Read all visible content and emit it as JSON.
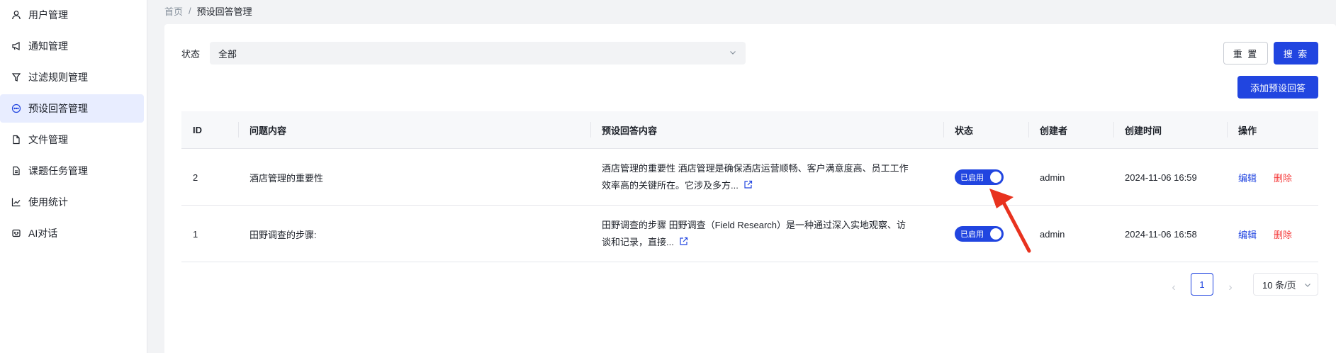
{
  "sidebar": {
    "items": [
      {
        "label": "用户管理",
        "icon": "user-icon"
      },
      {
        "label": "通知管理",
        "icon": "megaphone-icon"
      },
      {
        "label": "过滤规则管理",
        "icon": "filter-icon"
      },
      {
        "label": "预设回答管理",
        "icon": "chat-bubble-icon",
        "active": true
      },
      {
        "label": "文件管理",
        "icon": "file-icon"
      },
      {
        "label": "课题任务管理",
        "icon": "document-icon"
      },
      {
        "label": "使用统计",
        "icon": "line-chart-icon"
      },
      {
        "label": "AI对话",
        "icon": "robot-icon"
      }
    ]
  },
  "breadcrumb": {
    "home": "首页",
    "separator": "/",
    "current": "预设回答管理"
  },
  "filter": {
    "label": "状态",
    "value": "全部"
  },
  "buttons": {
    "reset": "重 置",
    "search": "搜 索",
    "add": "添加预设回答"
  },
  "table": {
    "headers": [
      "ID",
      "问题内容",
      "预设回答内容",
      "状态",
      "创建者",
      "创建时间",
      "操作"
    ],
    "rows": [
      {
        "id": "2",
        "question": "酒店管理的重要性",
        "answer_line1": "酒店管理的重要性 酒店管理是确保酒店运营顺畅、客户满意度高、员工工作",
        "answer_line2": "效率高的关键所在。它涉及多方...",
        "status": "已启用",
        "creator": "admin",
        "created_at": "2024-11-06 16:59",
        "edit": "编辑",
        "delete": "删除"
      },
      {
        "id": "1",
        "question": "田野调查的步骤:",
        "answer_line1": "田野调查的步骤 田野调查（Field Research）是一种通过深入实地观察、访",
        "answer_line2": "谈和记录，直接...",
        "status": "已启用",
        "creator": "admin",
        "created_at": "2024-11-06 16:58",
        "edit": "编辑",
        "delete": "删除"
      }
    ]
  },
  "pagination": {
    "prev": "‹",
    "current_page": "1",
    "next": "›",
    "page_size": "10 条/页"
  },
  "colors": {
    "primary": "#2145e0",
    "danger": "#f53f3f",
    "annotation_arrow": "#e8321e"
  }
}
